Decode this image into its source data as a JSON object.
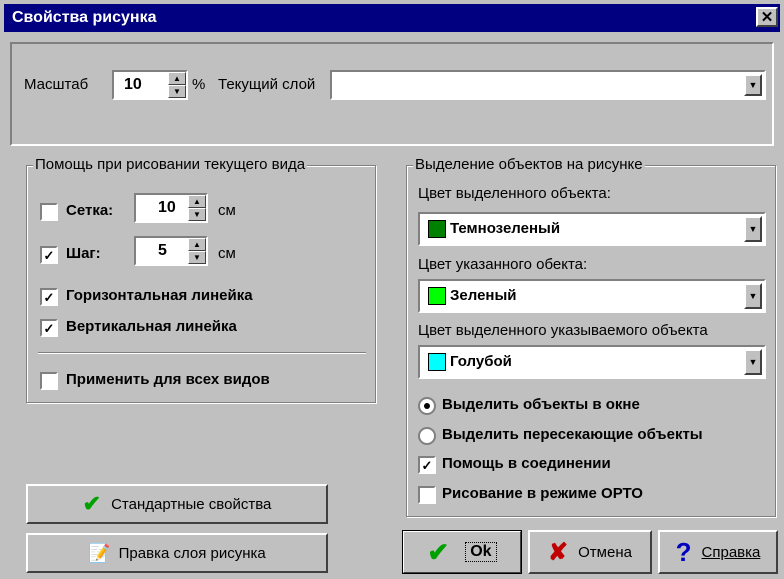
{
  "window": {
    "title": "Свойства рисунка",
    "close": "✕"
  },
  "top": {
    "scale_label": "Масштаб",
    "scale_value": "10",
    "scale_unit": "%",
    "layer_label": "Текущий слой",
    "layer_value": ""
  },
  "help": {
    "title": "Помощь при рисовании текущего вида",
    "grid": {
      "label": "Сетка:",
      "checked": false,
      "value": "10",
      "unit": "см"
    },
    "step": {
      "label": "Шаг:",
      "checked": true,
      "value": "5",
      "unit": "см"
    },
    "hruler": {
      "label": "Горизонтальная линейка",
      "checked": true
    },
    "vruler": {
      "label": "Вертикальная линейка",
      "checked": true
    },
    "apply_all": {
      "label": "Применить для всех видов",
      "checked": false
    }
  },
  "selection": {
    "title": "Выделение объектов на рисунке",
    "sel_color_label": "Цвет выделенного объекта:",
    "sel_color": {
      "name": "Темнозеленый",
      "color": "#008000"
    },
    "point_color_label": "Цвет указанного обекта:",
    "point_color": {
      "name": "Зеленый",
      "color": "#00ff00"
    },
    "selpoint_color_label": "Цвет выделенного указываемого объекта",
    "selpoint_color": {
      "name": "Голубой",
      "color": "#00ffff"
    },
    "radio_window": {
      "label": "Выделить объекты в окне",
      "checked": true
    },
    "radio_cross": {
      "label": "Выделить пересекающие объекты",
      "checked": false
    },
    "connect_help": {
      "label": "Помощь в соединении",
      "checked": true
    },
    "ortho": {
      "label": "Рисование в режиме ОРТО",
      "checked": false
    }
  },
  "buttons": {
    "defaults": "Стандартные свойства",
    "edit_layer": "Правка слоя рисунка",
    "ok": "Ok",
    "cancel": "Отмена",
    "help": "Справка"
  },
  "colors": {
    "titlebar": "#000080",
    "face": "#c0c0c0",
    "check_green": "#00a000",
    "cancel_red": "#c00000",
    "help_blue": "#0000c0"
  }
}
